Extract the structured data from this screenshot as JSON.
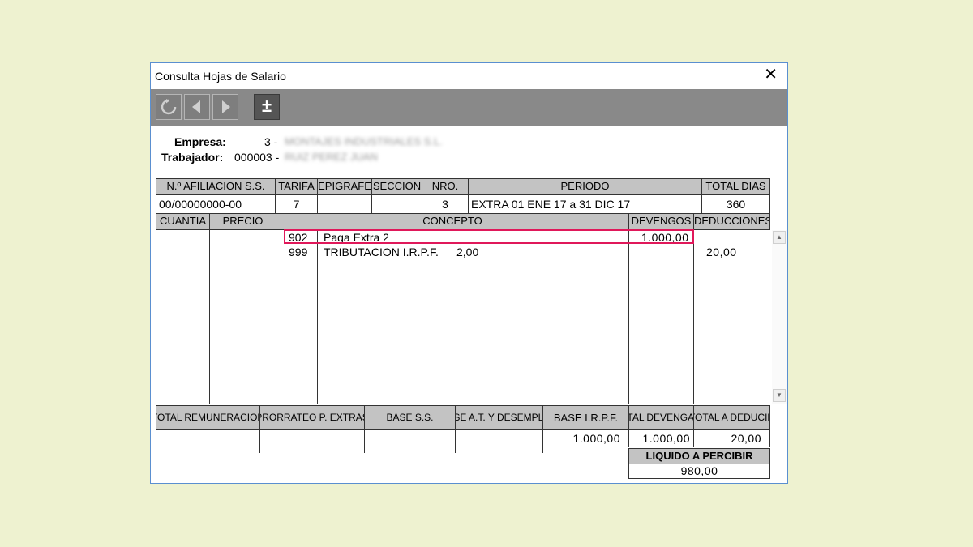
{
  "window": {
    "title": "Consulta Hojas de Salario",
    "close": "✕"
  },
  "toolbar": {
    "refresh": "refresh-icon",
    "prev": "arrow-left-icon",
    "next": "arrow-right-icon",
    "toggle": "±"
  },
  "header": {
    "empresa_label": "Empresa:",
    "empresa_code": "3 -",
    "empresa_name": "MONTAJES INDUSTRIALES S.L.",
    "trabajador_label": "Trabajador:",
    "trabajador_code": "000003 -",
    "trabajador_name": "RUIZ PEREZ JUAN"
  },
  "top_table": {
    "headers": [
      "N.º AFILIACION S.S.",
      "TARIFA",
      "EPIGRAFE",
      "SECCION",
      "NRO.",
      "PERIODO",
      "TOTAL DIAS"
    ],
    "row": [
      "00/00000000-00",
      "7",
      "",
      "",
      "3",
      "EXTRA 01 ENE 17 a 31 DIC 17",
      "360"
    ]
  },
  "concepts": {
    "headers": [
      "CUANTIA",
      "PRECIO",
      "CONCEPTO",
      "DEVENGOS",
      "DEDUCCIONES"
    ],
    "rows": [
      {
        "code": "902",
        "desc": "Paga Extra 2",
        "extra": "",
        "devengos": "1.000,00",
        "deducciones": ""
      },
      {
        "code": "999",
        "desc": "TRIBUTACION I.R.P.F.",
        "extra": "2,00",
        "devengos": "",
        "deducciones": "20,00"
      }
    ]
  },
  "totals": {
    "headers": [
      "TOTAL REMUNERACION",
      "PRORRATEO P. EXTRAS",
      "BASE S.S.",
      "BASE A.T. Y DESEMPLEO",
      "BASE I.R.P.F.",
      "TOTAL DEVENGADO",
      "TOTAL A DEDUCIR"
    ],
    "values": [
      "",
      "",
      "",
      "",
      "1.000,00",
      "1.000,00",
      "20,00"
    ]
  },
  "liquido": {
    "label": "LIQUIDO A PERCIBIR",
    "value": "980,00"
  },
  "colors": {
    "highlight": "#e0185a",
    "toolbar": "#898989",
    "header_bg": "#c3c3c3",
    "page_bg": "#eef2d0"
  }
}
